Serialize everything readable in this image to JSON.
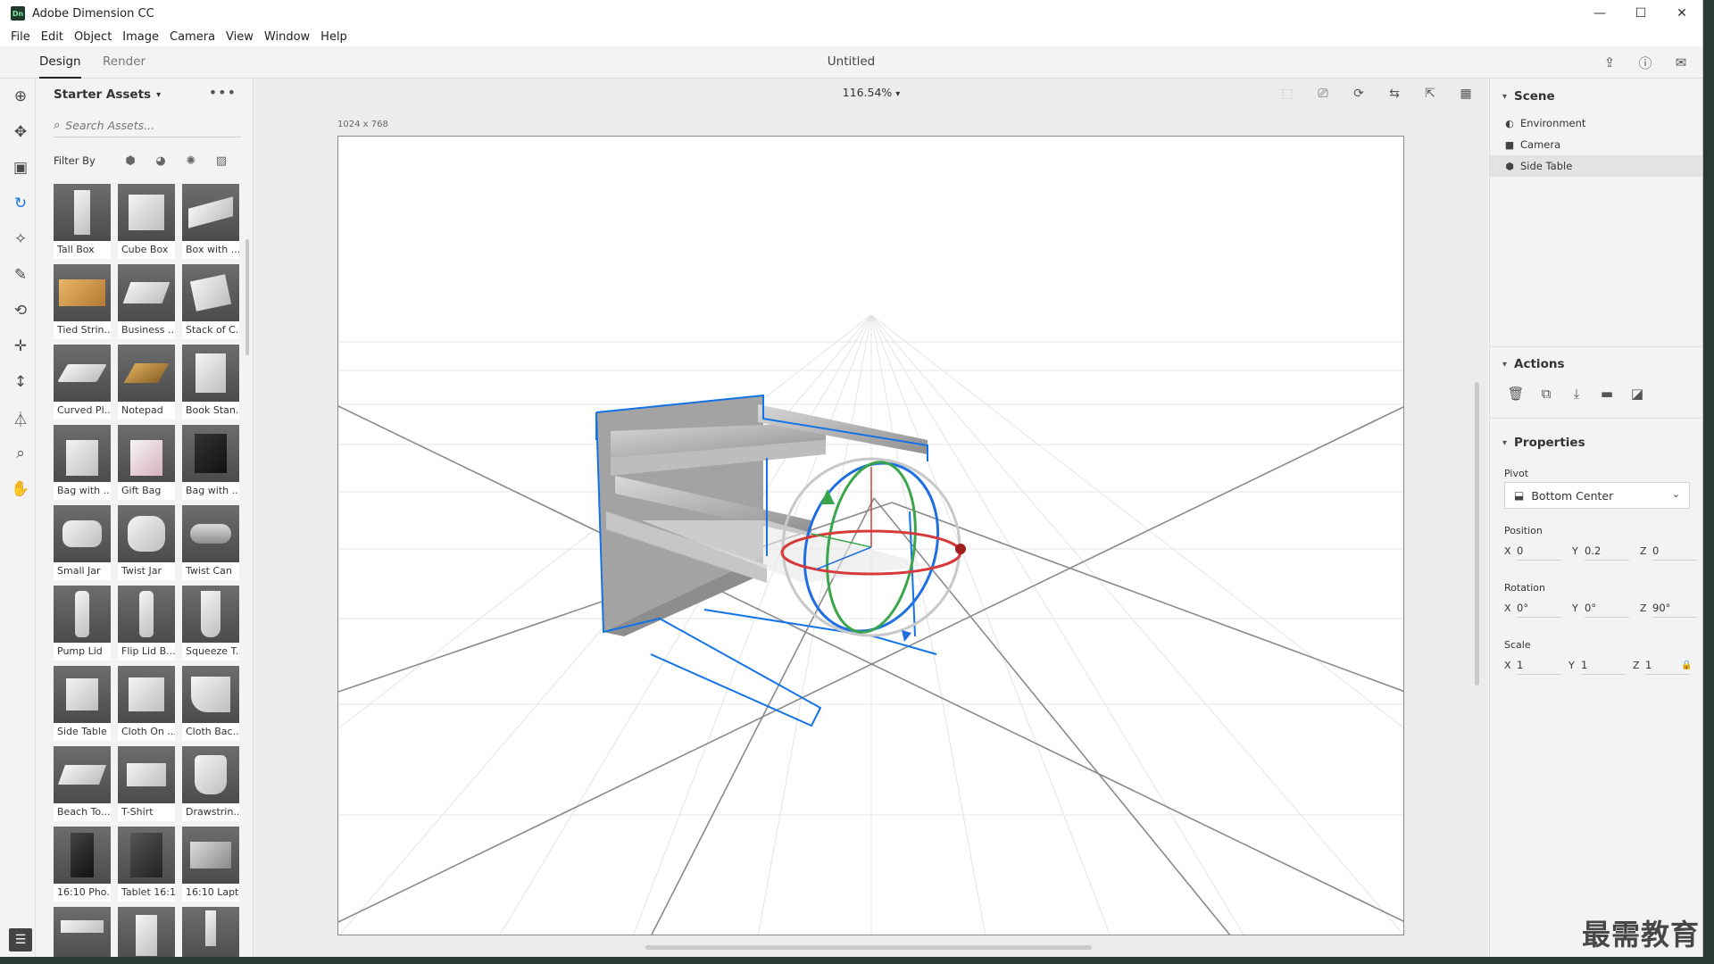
{
  "window": {
    "app_logo_text": "Dn",
    "title": "Adobe Dimension CC",
    "minimize": "—",
    "maximize": "☐",
    "close": "✕"
  },
  "menu": [
    "File",
    "Edit",
    "Object",
    "Image",
    "Camera",
    "View",
    "Window",
    "Help"
  ],
  "tabs": {
    "design": "Design",
    "render": "Render"
  },
  "document_title": "Untitled",
  "assets_panel": {
    "title": "Starter Assets",
    "more": "•••",
    "search_placeholder": "Search Assets...",
    "filter_label": "Filter By",
    "items": [
      "Tall Box",
      "Cube Box",
      "Box with ...",
      "Tied Strin...",
      "Business ...",
      "Stack of C...",
      "Curved Pl...",
      "Notepad",
      "Book Stan...",
      "Bag with ...",
      "Gift Bag",
      "Bag with ...",
      "Small Jar",
      "Twist Jar",
      "Twist Can",
      "Pump Lid",
      "Flip Lid B...",
      "Squeeze T...",
      "Side Table",
      "Cloth On ...",
      "Cloth Bac...",
      "Beach To...",
      "T-Shirt",
      "Drawstrin...",
      "16:10 Pho...",
      "Tablet 16:10",
      "16:10 Lapt..."
    ]
  },
  "viewport": {
    "zoom": "116.54%",
    "canvas_size": "1024 x 768"
  },
  "scene": {
    "title": "Scene",
    "items": [
      "Environment",
      "Camera",
      "Side Table"
    ]
  },
  "actions": {
    "title": "Actions"
  },
  "properties": {
    "title": "Properties",
    "pivot_label": "Pivot",
    "pivot_value": "Bottom Center",
    "position_label": "Position",
    "position": {
      "x": "0",
      "y": "0.2",
      "z": "0"
    },
    "rotation_label": "Rotation",
    "rotation": {
      "x": "0°",
      "y": "0°",
      "z": "90°"
    },
    "scale_label": "Scale",
    "scale": {
      "x": "1",
      "y": "1",
      "z": "1"
    }
  },
  "axis_labels": {
    "x": "X",
    "y": "Y",
    "z": "Z"
  },
  "colors": {
    "selection": "#1473e6",
    "gizmo_x": "#d63a3a",
    "gizmo_y": "#3aa54a",
    "gizmo_z": "#1f6fe0"
  },
  "watermark": "最需教育"
}
